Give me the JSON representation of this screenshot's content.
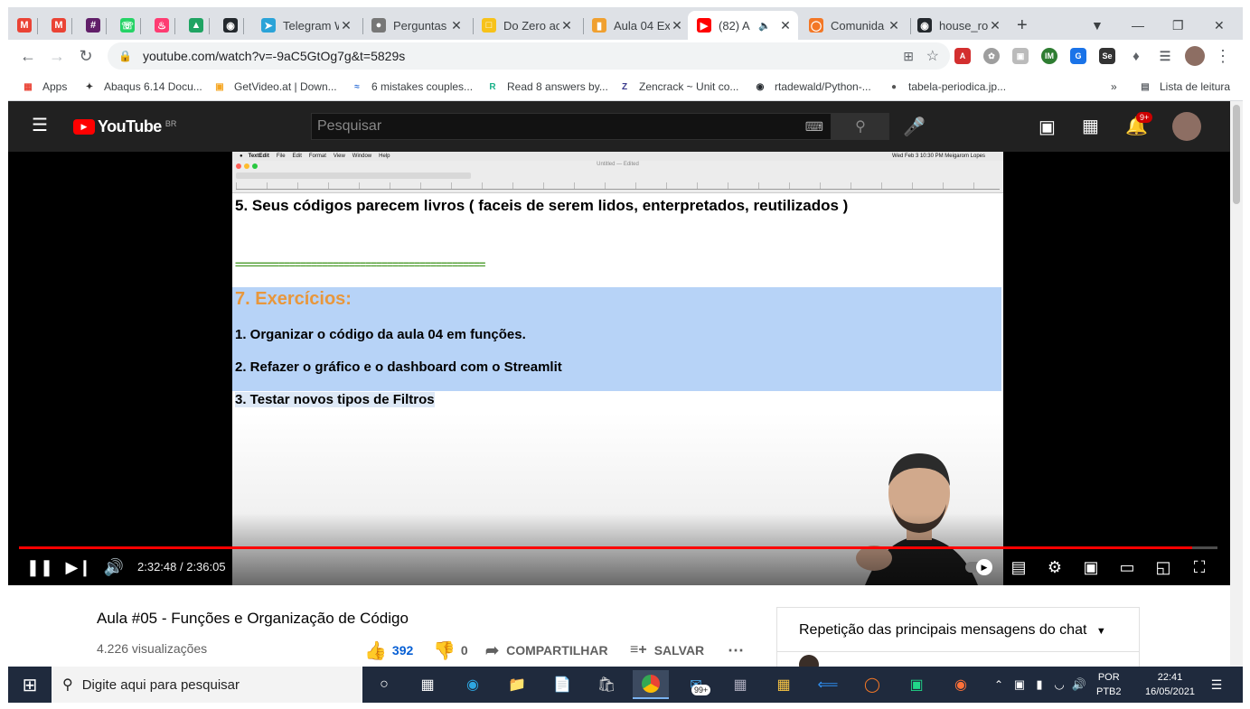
{
  "tabs": [
    {
      "label": "",
      "icon": "gmail-icon"
    },
    {
      "label": "",
      "icon": "gmail-icon"
    },
    {
      "label": "",
      "icon": "slack-icon"
    },
    {
      "label": "",
      "icon": "whatsapp-icon"
    },
    {
      "label": "",
      "icon": "tinder-icon"
    },
    {
      "label": "",
      "icon": "google-drive-icon"
    },
    {
      "label": "",
      "icon": "github-icon"
    },
    {
      "label": "Telegram W",
      "icon": "telegram-icon"
    },
    {
      "label": "Perguntas",
      "icon": "globe-icon"
    },
    {
      "label": "Do Zero ao",
      "icon": "notes-icon"
    },
    {
      "label": "Aula 04 Ex",
      "icon": "doc-icon"
    },
    {
      "label": "(82) A",
      "icon": "youtube-icon"
    },
    {
      "label": "Comunida",
      "icon": "jupyter-icon"
    },
    {
      "label": "house_roc",
      "icon": "github-icon"
    }
  ],
  "toolbar": {
    "url": "youtube.com/watch?v=-9aC5GtOg7g&t=5829s"
  },
  "bookmarks": [
    {
      "label": "Apps"
    },
    {
      "label": "Abaqus 6.14 Docu..."
    },
    {
      "label": "GetVideo.at | Down..."
    },
    {
      "label": "6 mistakes couples..."
    },
    {
      "label": "Read 8 answers by..."
    },
    {
      "label": "Zencrack ~ Unit co..."
    },
    {
      "label": "rtadewald/Python-..."
    },
    {
      "label": "tabela-periodica.jp..."
    }
  ],
  "bookmarks_more": "»",
  "reading_list": "Lista de leitura",
  "youtube": {
    "logo": "YouTube",
    "country": "BR",
    "search_placeholder": "Pesquisar",
    "notif_badge": "9+"
  },
  "slide": {
    "mac_menu": [
      "TextEdit",
      "File",
      "Edit",
      "Format",
      "View",
      "Window",
      "Help"
    ],
    "mac_status": "Wed Feb 3  10:30 PM   Meigarom Lopes",
    "window_title": "Untitled — Edited",
    "line5": "5. Seus códigos parecem livros ( faceis de serem lidos, enterpretados, reutilizados )",
    "divider": "==============================================",
    "heading": "7. Exercícios:",
    "ex1": "1. Organizar o código da aula 04 em funções.",
    "ex2": "2. Refazer o gráfico e o dashboard com o Streamlit",
    "ex3": "3. Testar novos tipos de Filtros"
  },
  "player": {
    "time": "2:32:48 / 2:36:05",
    "progress": 0.979
  },
  "video": {
    "title": "Aula #05 - Funções e Organização de Código",
    "views": "4.226 visualizações",
    "likes": "392",
    "dislikes": "0",
    "share": "COMPARTILHAR",
    "save": "SALVAR"
  },
  "chat": {
    "title": "Repetição das principais mensagens do chat"
  },
  "taskbar": {
    "search_placeholder": "Digite aqui para pesquisar",
    "mail_badge": "99+",
    "lang1": "POR",
    "lang2": "PTB2",
    "time": "22:41",
    "date": "16/05/2021"
  },
  "colors": {
    "youtube_red": "#ff0000",
    "like_blue": "#065fd4",
    "highlight": "#b7d3f7",
    "heading_orange": "#e8973c"
  }
}
